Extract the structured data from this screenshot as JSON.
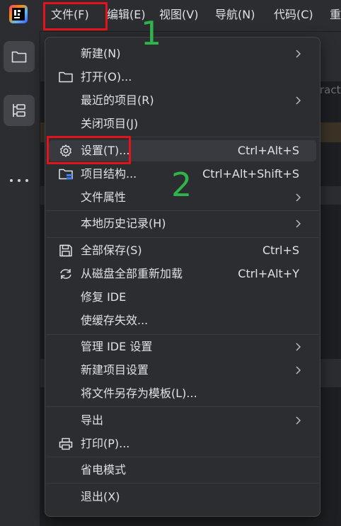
{
  "menubar": {
    "items": [
      {
        "label": "文件(F)"
      },
      {
        "label": "编辑(E)"
      },
      {
        "label": "视图(V)"
      },
      {
        "label": "导航(N)"
      },
      {
        "label": "代码(C)"
      },
      {
        "label": "重"
      }
    ]
  },
  "background": {
    "partial_text": "ract"
  },
  "file_menu": {
    "groups": [
      [
        {
          "label": "新建(N)",
          "shortcut": "",
          "submenu": true,
          "icon": ""
        },
        {
          "label": "打开(O)...",
          "shortcut": "",
          "submenu": false,
          "icon": "folder-icon"
        },
        {
          "label": "最近的项目(R)",
          "shortcut": "",
          "submenu": true,
          "icon": ""
        },
        {
          "label": "关闭项目(J)",
          "shortcut": "",
          "submenu": false,
          "icon": ""
        }
      ],
      [
        {
          "label": "设置(T)...",
          "shortcut": "Ctrl+Alt+S",
          "submenu": false,
          "icon": "gear-icon"
        },
        {
          "label": "项目结构...",
          "shortcut": "Ctrl+Alt+Shift+S",
          "submenu": false,
          "icon": "project-structure-icon"
        },
        {
          "label": "文件属性",
          "shortcut": "",
          "submenu": true,
          "icon": ""
        }
      ],
      [
        {
          "label": "本地历史记录(H)",
          "shortcut": "",
          "submenu": true,
          "icon": ""
        }
      ],
      [
        {
          "label": "全部保存(S)",
          "shortcut": "Ctrl+S",
          "submenu": false,
          "icon": "save-icon"
        },
        {
          "label": "从磁盘全部重新加载",
          "shortcut": "Ctrl+Alt+Y",
          "submenu": false,
          "icon": "reload-icon"
        },
        {
          "label": "修复 IDE",
          "shortcut": "",
          "submenu": false,
          "icon": ""
        },
        {
          "label": "使缓存失效...",
          "shortcut": "",
          "submenu": false,
          "icon": ""
        }
      ],
      [
        {
          "label": "管理 IDE 设置",
          "shortcut": "",
          "submenu": true,
          "icon": ""
        },
        {
          "label": "新建项目设置",
          "shortcut": "",
          "submenu": true,
          "icon": ""
        },
        {
          "label": "将文件另存为模板(L)...",
          "shortcut": "",
          "submenu": false,
          "icon": ""
        }
      ],
      [
        {
          "label": "导出",
          "shortcut": "",
          "submenu": true,
          "icon": ""
        },
        {
          "label": "打印(P)...",
          "shortcut": "",
          "submenu": false,
          "icon": "print-icon"
        }
      ],
      [
        {
          "label": "省电模式",
          "shortcut": "",
          "submenu": false,
          "icon": ""
        }
      ],
      [
        {
          "label": "退出(X)",
          "shortcut": "",
          "submenu": false,
          "icon": ""
        }
      ]
    ]
  },
  "annotations": {
    "step1": "1",
    "step2": "2"
  },
  "colors": {
    "annotation_box": "#e3121b",
    "annotation_number": "#2fb34a",
    "menu_bg": "#2b2d30",
    "highlight": "#383a3f"
  }
}
